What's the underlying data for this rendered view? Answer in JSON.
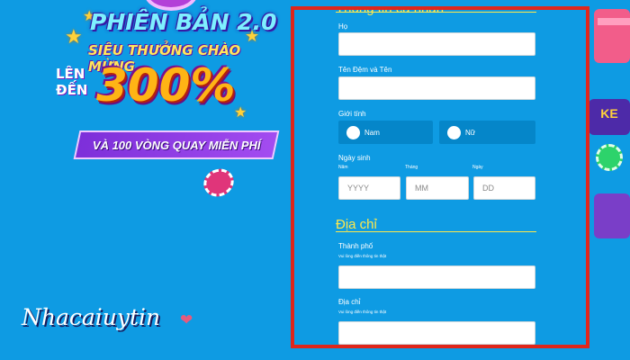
{
  "promo": {
    "title_line1": "PHIÊN BẢN 2.0",
    "title_line2": "SIÊU THƯỞNG CHÀO MỪNG",
    "len": "LÊN",
    "den": "ĐẾN",
    "percent": "300%",
    "ribbon": "VÀ 100 VÒNG QUAY MIỄN PHÍ"
  },
  "watermark": "Nhacaiuytin",
  "decor_right": {
    "slot_sign": "KE"
  },
  "form": {
    "section_personal": "Thông tin cá nhân",
    "ho": {
      "label": "Họ",
      "value": ""
    },
    "ten_dem_va_ten": {
      "label": "Tên Đệm và Tên",
      "value": ""
    },
    "gioi_tinh": {
      "label": "Giới tính",
      "options": [
        "Nam",
        "Nữ"
      ]
    },
    "ngay_sinh": {
      "label": "Ngày sinh",
      "year_label": "Năm",
      "month_label": "Tháng",
      "day_label": "Ngày",
      "year_placeholder": "YYYY",
      "month_placeholder": "MM",
      "day_placeholder": "DD"
    },
    "section_address": "Địa chỉ",
    "thanh_pho": {
      "label": "Thành phố",
      "hint": "Vui lòng điền thông tin thật",
      "value": ""
    },
    "dia_chi": {
      "label": "Địa chỉ",
      "hint": "Vui lòng điền thông tin thật",
      "value": ""
    }
  },
  "colors": {
    "background": "#0e9be3",
    "frame_border": "#e0261b",
    "section_title": "#ffe84a",
    "radio_box": "#0586c9"
  }
}
